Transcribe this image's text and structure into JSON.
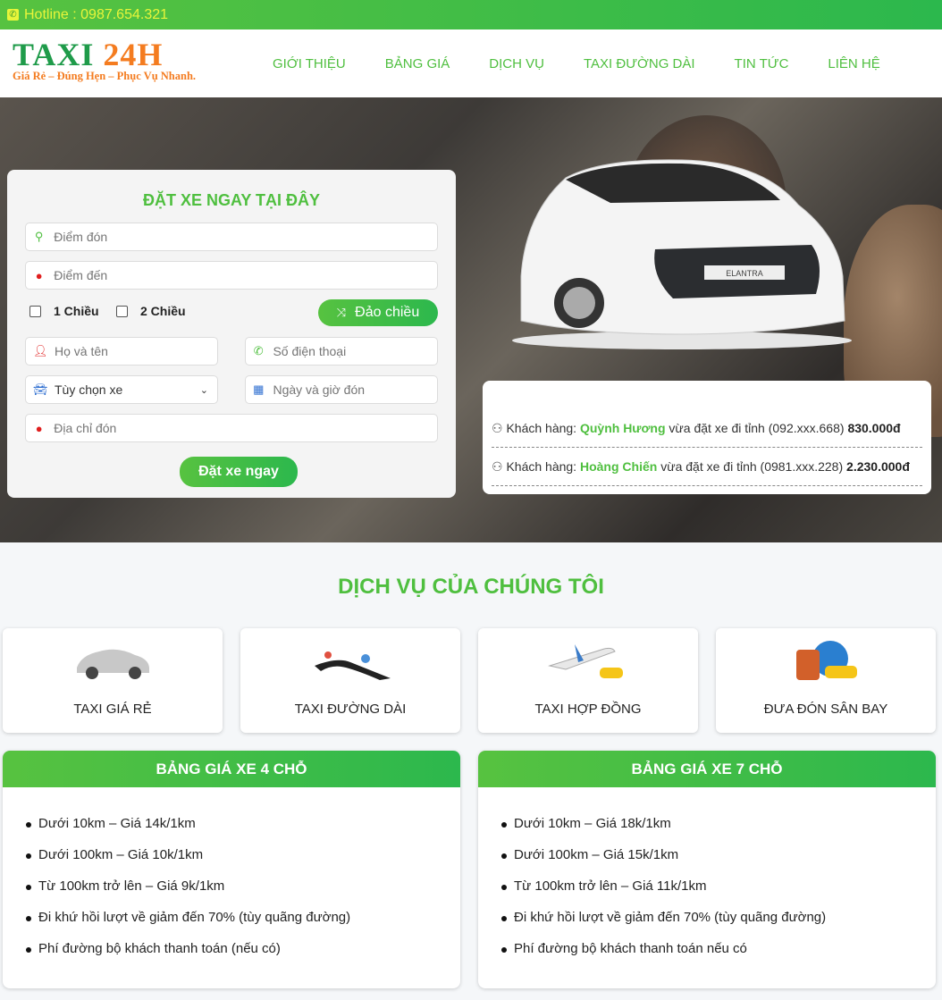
{
  "topbar": {
    "hotline": "Hotline : 0987.654.321",
    "phone_icon": "phone-icon"
  },
  "header": {
    "logo": {
      "word1": "TAXI",
      "word2": "24H",
      "tagline": "Giá Rẻ – Đúng Hẹn – Phục Vụ Nhanh."
    },
    "nav": [
      "GIỚI THIỆU",
      "BẢNG GIÁ",
      "DỊCH VỤ",
      "TAXI ĐƯỜNG DÀI",
      "TIN TỨC",
      "LIÊN HỆ"
    ]
  },
  "booking": {
    "title": "ĐẶT XE NGAY TẠI ĐÂY",
    "pickup_placeholder": "Điểm đón",
    "destination_placeholder": "Điểm đến",
    "one_way": "1 Chiều",
    "two_way": "2 Chiều",
    "swap_label": "Đảo chiều",
    "name_placeholder": "Họ và tên",
    "phone_placeholder": "Số điện thoại",
    "car_select": "Tùy chọn xe",
    "datetime_placeholder": "Ngày và giờ đón",
    "address_placeholder": "Địa chỉ đón",
    "submit_label": "Đặt xe ngay"
  },
  "hero": {
    "car_plate": "ELANTRA"
  },
  "orders": [
    {
      "prefix": "Khách hàng:",
      "name": "Quỳnh Hương",
      "text": "vừa đặt xe đi tỉnh (092.xxx.668)",
      "amount": "830.000đ"
    },
    {
      "prefix": "Khách hàng:",
      "name": "Hoàng Chiến",
      "text": "vừa đặt xe đi tỉnh (0981.xxx.228)",
      "amount": "2.230.000đ"
    }
  ],
  "services": {
    "title": "DỊCH VỤ CỦA CHÚNG TÔI",
    "items": [
      "TAXI GIÁ RẺ",
      "TAXI ĐƯỜNG DÀI",
      "TAXI HỢP ĐỒNG",
      "ĐƯA ĐÓN SÂN BAY"
    ]
  },
  "pricing": [
    {
      "title": "BẢNG GIÁ XE 4 CHỖ",
      "items": [
        "Dưới 10km – Giá 14k/1km",
        "Dưới 100km – Giá 10k/1km",
        "Từ 100km trở lên – Giá 9k/1km",
        "Đi khứ hồi lượt về giảm đến 70% (tùy quãng đường)",
        "Phí đường bộ khách thanh toán (nếu có)"
      ]
    },
    {
      "title": "BẢNG GIÁ XE 7 CHỖ",
      "items": [
        "Dưới 10km – Giá 18k/1km",
        "Dưới 100km – Giá 15k/1km",
        "Từ 100km trở lên – Giá 11k/1km",
        "Đi khứ hồi lượt về giảm đến 70% (tùy quãng đường)",
        "Phí đường bộ khách thanh toán nếu có"
      ]
    }
  ],
  "colors": {
    "brand_green": "#4fbf3f",
    "accent_orange": "#f47c20",
    "hotline_yellow": "#e8f53a"
  }
}
